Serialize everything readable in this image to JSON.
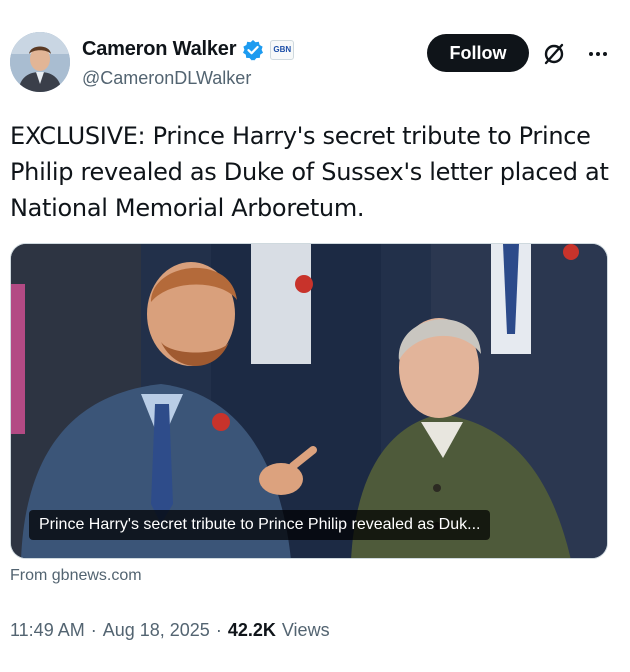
{
  "author": {
    "display_name": "Cameron Walker",
    "handle": "@CameronDLWalker",
    "affiliate_badge": "GBN",
    "avatar_icon": "profile-photo",
    "verified_icon": "verified-badge-icon",
    "verified_color": "#1d9bf0"
  },
  "actions": {
    "follow_label": "Follow",
    "grok_icon": "grok-icon",
    "more_icon": "more-icon"
  },
  "tweet": {
    "text": "EXCLUSIVE: Prince Harry's secret tribute to Prince Philip revealed as Duke of Sussex's letter placed at National Memorial Arboretum."
  },
  "card": {
    "caption": "Prince Harry's secret tribute to Prince Philip revealed as Duk...",
    "source": "From gbnews.com"
  },
  "meta": {
    "time": "11:49 AM",
    "separator": "·",
    "date": "Aug 18, 2025",
    "views_count": "42.2K",
    "views_label": "Views"
  },
  "colors": {
    "text_primary": "#0f1419",
    "text_secondary": "#536471",
    "follow_bg": "#0f1419"
  }
}
